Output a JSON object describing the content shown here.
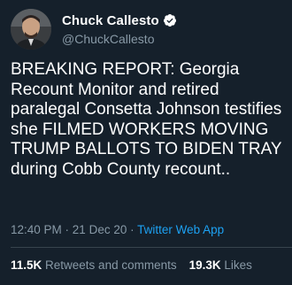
{
  "author": {
    "display_name": "Chuck Callesto",
    "handle": "@ChuckCallesto",
    "verified_icon": "verified-badge-icon",
    "avatar_icon": "profile-photo"
  },
  "tweet": {
    "text": "BREAKING REPORT: Georgia Recount Monitor and retired paralegal Consetta Johnson testifies she FILMED WORKERS MOVING TRUMP BALLOTS TO BIDEN TRAY during Cobb County recount..",
    "time": "12:40 PM",
    "separator1": " · ",
    "date": "21 Dec 20",
    "separator2": " · ",
    "source": "Twitter Web App"
  },
  "stats": {
    "retweets_count": "11.5K",
    "retweets_label": " Retweets and comments",
    "likes_count": "19.3K",
    "likes_label": " Likes"
  },
  "colors": {
    "background": "#15202b",
    "text_primary": "#ffffff",
    "text_secondary": "#8899a6",
    "accent": "#1da1f2",
    "divider": "#38444d"
  }
}
